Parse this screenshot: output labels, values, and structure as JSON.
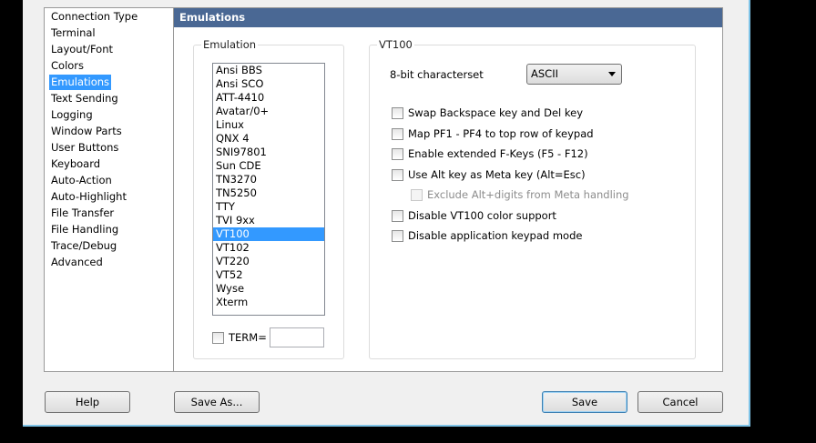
{
  "nav": {
    "items": [
      "Connection Type",
      "Terminal",
      "Layout/Font",
      "Colors",
      "Emulations",
      "Text Sending",
      "Logging",
      "Window Parts",
      "User Buttons",
      "Keyboard",
      "Auto-Action",
      "Auto-Highlight",
      "File Transfer",
      "File Handling",
      "Trace/Debug",
      "Advanced"
    ],
    "selected": "Emulations"
  },
  "header": {
    "title": "Emulations"
  },
  "emulation": {
    "label": "Emulation",
    "items": [
      "Ansi BBS",
      "Ansi SCO",
      "ATT-4410",
      "Avatar/0+",
      "Linux",
      "QNX 4",
      "SNI97801",
      "Sun CDE",
      "TN3270",
      "TN5250",
      "TTY",
      "TVI 9xx",
      "VT100",
      "VT102",
      "VT220",
      "VT52",
      "Wyse",
      "Xterm"
    ],
    "selected": "VT100",
    "term_label": "TERM=",
    "term_value": "",
    "term_checked": false
  },
  "vt100": {
    "label": "VT100",
    "charset_label": "8-bit characterset",
    "charset_value": "ASCII",
    "options": [
      {
        "label": "Swap Backspace key and Del key",
        "checked": false,
        "enabled": true
      },
      {
        "label": "Map PF1 - PF4 to top row of keypad",
        "checked": false,
        "enabled": true
      },
      {
        "label": "Enable extended F-Keys (F5 - F12)",
        "checked": false,
        "enabled": true
      },
      {
        "label": "Use Alt key as Meta key (Alt=Esc)",
        "checked": false,
        "enabled": true
      },
      {
        "label": "Exclude Alt+digits from Meta handling",
        "checked": false,
        "enabled": false
      },
      {
        "label": "Disable VT100 color support",
        "checked": false,
        "enabled": true
      },
      {
        "label": "Disable application keypad mode",
        "checked": false,
        "enabled": true
      }
    ]
  },
  "buttons": {
    "help": "Help",
    "save_as": "Save As...",
    "save": "Save",
    "cancel": "Cancel"
  }
}
